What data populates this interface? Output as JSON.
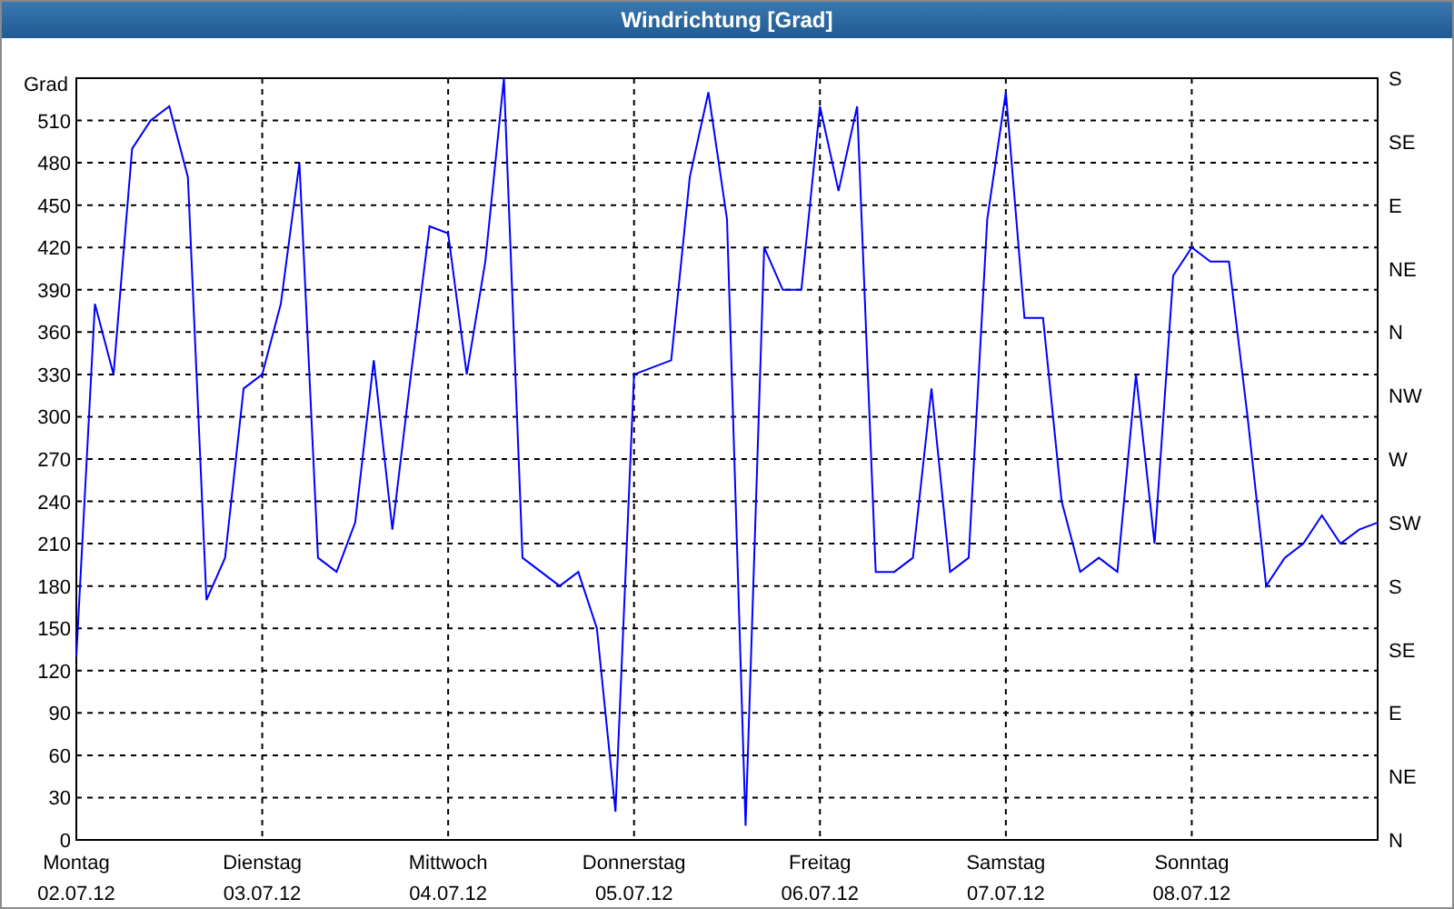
{
  "window": {
    "title": "Windrichtung [Grad]"
  },
  "chart": {
    "compass_ticks": [
      "S",
      "SE",
      "E",
      "NE",
      "N",
      "NW",
      "W",
      "SW",
      "S",
      "SE",
      "E",
      "NE",
      "N"
    ],
    "dates": [
      "02.07.12",
      "03.07.12",
      "04.07.12",
      "05.07.12",
      "06.07.12",
      "07.07.12",
      "08.07.12"
    ],
    "chart_data": {
      "type": "line",
      "grid": true,
      "ylabel": "Grad",
      "ylim": [
        0,
        540
      ],
      "yticks": [
        0,
        30,
        60,
        90,
        120,
        150,
        180,
        210,
        240,
        270,
        300,
        330,
        360,
        390,
        420,
        450,
        480,
        510
      ],
      "categories": [
        "Montag",
        null,
        null,
        null,
        null,
        null,
        null,
        null,
        null,
        null,
        "Dienstag",
        null,
        null,
        null,
        null,
        null,
        null,
        null,
        null,
        null,
        "Mittwoch",
        null,
        null,
        null,
        null,
        null,
        null,
        null,
        null,
        null,
        "Donnerstag",
        null,
        null,
        null,
        null,
        null,
        null,
        null,
        null,
        null,
        "Freitag",
        null,
        null,
        null,
        null,
        null,
        null,
        null,
        null,
        null,
        "Samstag",
        null,
        null,
        null,
        null,
        null,
        null,
        null,
        null,
        null,
        "Sonntag",
        null,
        null,
        null,
        null,
        null,
        null,
        null,
        null,
        null,
        null
      ],
      "series": [
        {
          "color": "#0000ff",
          "values": [
            130,
            380,
            330,
            490,
            510,
            520,
            470,
            170,
            200,
            320,
            330,
            380,
            480,
            200,
            190,
            225,
            340,
            220,
            330,
            435,
            430,
            330,
            410,
            540,
            200,
            190,
            180,
            190,
            150,
            20,
            330,
            335,
            340,
            470,
            530,
            440,
            10,
            420,
            390,
            390,
            520,
            460,
            520,
            190,
            190,
            200,
            320,
            190,
            200,
            440,
            530,
            370,
            370,
            240,
            190,
            200,
            190,
            330,
            210,
            400,
            420,
            410,
            410,
            300,
            180,
            200,
            210,
            230,
            210,
            220,
            225
          ]
        }
      ]
    }
  }
}
